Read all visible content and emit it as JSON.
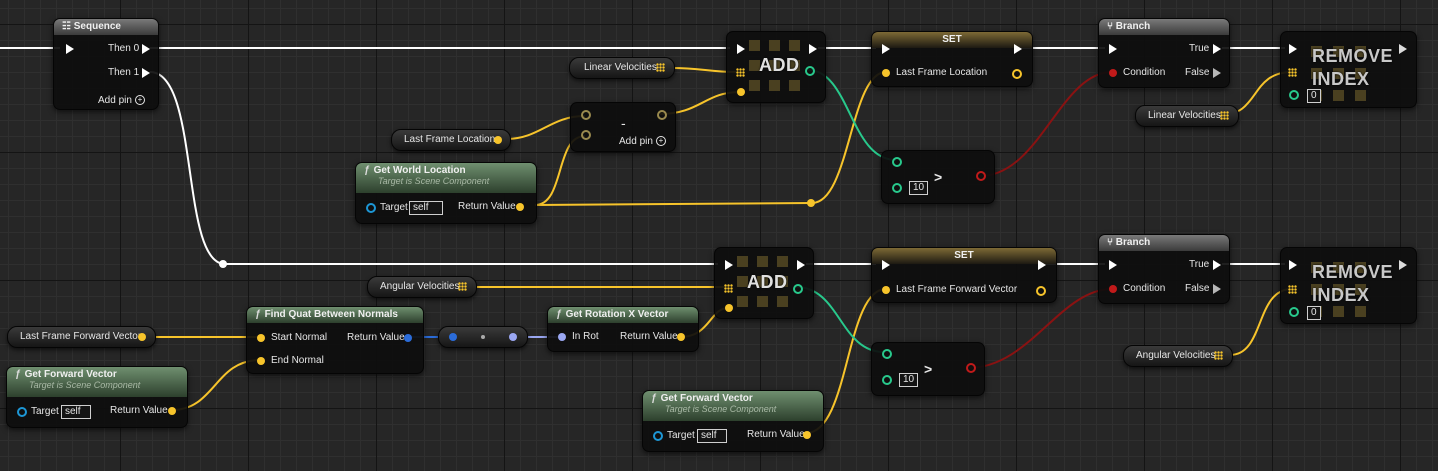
{
  "sequence": {
    "title": "Sequence",
    "then0": "Then 0",
    "then1": "Then 1",
    "add_pin": "Add pin"
  },
  "var_linear_velocities_top": {
    "label": "Linear Velocities"
  },
  "var_last_frame_location": {
    "label": "Last Frame Location"
  },
  "subtract": {
    "symbol": "-",
    "add_pin": "Add pin"
  },
  "get_world_location": {
    "title": "Get World Location",
    "subtitle": "Target is Scene Component",
    "target_label": "Target",
    "target_value": "self",
    "return_label": "Return Value"
  },
  "add_top": {
    "label": "ADD"
  },
  "set_top": {
    "title": "SET",
    "var_label": "Last Frame Location"
  },
  "compare_top": {
    "value": "10",
    "op": ">"
  },
  "branch_top": {
    "title": "Branch",
    "true_label": "True",
    "false_label": "False",
    "condition_label": "Condition"
  },
  "remove_top": {
    "label_line1": "REMOVE",
    "label_line2": "INDEX",
    "index_value": "0"
  },
  "var_linear_velocities_right": {
    "label": "Linear Velocities"
  },
  "var_angular_velocities_mid": {
    "label": "Angular Velocities"
  },
  "add_bottom": {
    "label": "ADD"
  },
  "set_bottom": {
    "title": "SET",
    "var_label": "Last Frame Forward Vector"
  },
  "compare_bottom": {
    "value": "10",
    "op": ">"
  },
  "branch_bottom": {
    "title": "Branch",
    "true_label": "True",
    "false_label": "False",
    "condition_label": "Condition"
  },
  "remove_bottom": {
    "label_line1": "REMOVE",
    "label_line2": "INDEX",
    "index_value": "0"
  },
  "var_angular_velocities_right": {
    "label": "Angular Velocities"
  },
  "var_last_frame_forward_vector": {
    "label": "Last Frame Forward Vector"
  },
  "find_quat": {
    "title": "Find Quat Between Normals",
    "start_label": "Start Normal",
    "end_label": "End Normal",
    "return_label": "Return Value"
  },
  "get_rotation_x": {
    "title": "Get Rotation X Vector",
    "in_label": "In Rot",
    "return_label": "Return Value"
  },
  "get_forward_vector_left": {
    "title": "Get Forward Vector",
    "subtitle": "Target is Scene Component",
    "target_label": "Target",
    "target_value": "self",
    "return_label": "Return Value"
  },
  "get_forward_vector_bottom": {
    "title": "Get Forward Vector",
    "subtitle": "Target is Scene Component",
    "target_label": "Target",
    "target_value": "self",
    "return_label": "Return Value"
  },
  "colors": {
    "exec": "#ffffff",
    "vector": "#f7c42b",
    "bool": "#c11a1a",
    "int": "#28c98c",
    "rotator": "#9aa7f2",
    "quat": "#2b6cd9",
    "graph_bg": "#262626"
  }
}
